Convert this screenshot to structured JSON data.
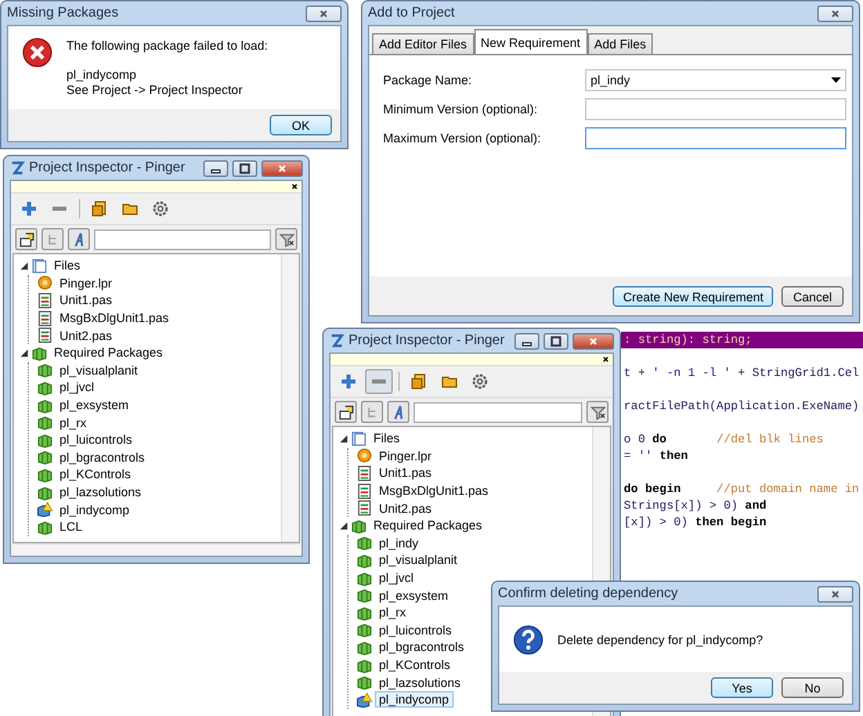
{
  "missing_packages_dialog": {
    "title": "Missing Packages",
    "message_lines": [
      "The following package failed to load:",
      "pl_indycomp",
      "See Project -> Project Inspector"
    ],
    "buttons": [
      {
        "label": "OK",
        "default": true
      }
    ]
  },
  "inspector_windows": [
    {
      "title": "Project Inspector - Pinger",
      "toolbar": [
        {
          "kind": "add",
          "pressed": false
        },
        {
          "kind": "remove",
          "pressed": false
        },
        {
          "kind": "open",
          "pressed": false
        },
        {
          "kind": "folder",
          "pressed": false
        },
        {
          "kind": "options",
          "pressed": false
        }
      ],
      "tree": [
        {
          "label": "Files",
          "kind": "files",
          "expanded": true,
          "selected": false,
          "children": [
            {
              "label": "Pinger.lpr",
              "kind": "project",
              "selected": false
            },
            {
              "label": "Unit1.pas",
              "kind": "unit",
              "selected": false
            },
            {
              "label": "MsgBxDlgUnit1.pas",
              "kind": "unit",
              "selected": false
            },
            {
              "label": "Unit2.pas",
              "kind": "unit",
              "selected": false
            }
          ]
        },
        {
          "label": "Required Packages",
          "kind": "packages",
          "expanded": true,
          "selected": false,
          "children": [
            {
              "label": "pl_visualplanit",
              "kind": "package",
              "selected": false
            },
            {
              "label": "pl_jvcl",
              "kind": "package",
              "selected": false
            },
            {
              "label": "pl_exsystem",
              "kind": "package",
              "selected": false
            },
            {
              "label": "pl_rx",
              "kind": "package",
              "selected": false
            },
            {
              "label": "pl_luicontrols",
              "kind": "package",
              "selected": false
            },
            {
              "label": "pl_bgracontrols",
              "kind": "package",
              "selected": false
            },
            {
              "label": "pl_KControls",
              "kind": "package",
              "selected": false
            },
            {
              "label": "pl_lazsolutions",
              "kind": "package",
              "selected": false
            },
            {
              "label": "pl_indycomp",
              "kind": "missing-package",
              "selected": false
            },
            {
              "label": "LCL",
              "kind": "package",
              "selected": false
            }
          ]
        }
      ]
    },
    {
      "title": "Project Inspector - Pinger",
      "toolbar": [
        {
          "kind": "add",
          "pressed": false
        },
        {
          "kind": "remove",
          "pressed": true
        },
        {
          "kind": "open",
          "pressed": false
        },
        {
          "kind": "folder",
          "pressed": false
        },
        {
          "kind": "options",
          "pressed": false
        }
      ],
      "tree": [
        {
          "label": "Files",
          "kind": "files",
          "expanded": true,
          "selected": false,
          "children": [
            {
              "label": "Pinger.lpr",
              "kind": "project",
              "selected": false
            },
            {
              "label": "Unit1.pas",
              "kind": "unit",
              "selected": false
            },
            {
              "label": "MsgBxDlgUnit1.pas",
              "kind": "unit",
              "selected": false
            },
            {
              "label": "Unit2.pas",
              "kind": "unit",
              "selected": false
            }
          ]
        },
        {
          "label": "Required Packages",
          "kind": "packages",
          "expanded": true,
          "selected": false,
          "children": [
            {
              "label": "pl_indy",
              "kind": "package",
              "selected": false
            },
            {
              "label": "pl_visualplanit",
              "kind": "package",
              "selected": false
            },
            {
              "label": "pl_jvcl",
              "kind": "package",
              "selected": false
            },
            {
              "label": "pl_exsystem",
              "kind": "package",
              "selected": false
            },
            {
              "label": "pl_rx",
              "kind": "package",
              "selected": false
            },
            {
              "label": "pl_luicontrols",
              "kind": "package",
              "selected": false
            },
            {
              "label": "pl_bgracontrols",
              "kind": "package",
              "selected": false
            },
            {
              "label": "pl_KControls",
              "kind": "package",
              "selected": false
            },
            {
              "label": "pl_lazsolutions",
              "kind": "package",
              "selected": false
            },
            {
              "label": "pl_indycomp",
              "kind": "missing-package",
              "selected": true
            }
          ]
        }
      ]
    }
  ],
  "add_to_project_dialog": {
    "title": "Add to Project",
    "tabs": [
      {
        "label": "Add Editor Files",
        "selected": false
      },
      {
        "label": "New Requirement",
        "selected": true
      },
      {
        "label": "Add Files",
        "selected": false
      }
    ],
    "fields": [
      {
        "label": "Package Name:",
        "kind": "combo",
        "value": "pl_indy",
        "focused": false
      },
      {
        "label": "Minimum Version (optional):",
        "kind": "text",
        "focused": false
      },
      {
        "label": "Maximum Version (optional):",
        "kind": "text",
        "focused": true
      }
    ],
    "buttons": [
      {
        "label": "Create New Requirement",
        "default": true
      },
      {
        "label": "Cancel",
        "default": false
      }
    ]
  },
  "source_editor": {
    "blocks": [
      [
        {
          "highlighted": true,
          "segments": [
            {
              "kind": "plain",
              "text": ": string): string;"
            }
          ]
        }
      ],
      [
        {
          "highlighted": false,
          "segments": [
            {
              "kind": "plain",
              "text": "t + "
            },
            {
              "kind": "string",
              "text": "' -n 1 -l '"
            },
            {
              "kind": "plain",
              "text": " + StringGrid1.Cel"
            }
          ]
        }
      ],
      [
        {
          "highlighted": false,
          "segments": [
            {
              "kind": "plain",
              "text": "ractFilePath(Application.ExeName)"
            }
          ]
        }
      ],
      [
        {
          "highlighted": false,
          "segments": [
            {
              "kind": "plain",
              "text": "o 0 "
            },
            {
              "kind": "keyword",
              "text": "do"
            },
            {
              "kind": "comment",
              "text": "       //del blk lines"
            }
          ]
        },
        {
          "highlighted": false,
          "segments": [
            {
              "kind": "plain",
              "text": "= "
            },
            {
              "kind": "string",
              "text": "''"
            },
            {
              "kind": "keyword",
              "text": " then"
            }
          ]
        }
      ],
      [
        {
          "highlighted": false,
          "segments": [
            {
              "kind": "keyword",
              "text": "do begin"
            },
            {
              "kind": "comment",
              "text": "     //put domain name in"
            }
          ]
        },
        {
          "highlighted": false,
          "segments": [
            {
              "kind": "plain",
              "text": "Strings[x]) > 0) "
            },
            {
              "kind": "keyword",
              "text": "and"
            }
          ]
        },
        {
          "highlighted": false,
          "segments": [
            {
              "kind": "plain",
              "text": "[x]) > 0) "
            },
            {
              "kind": "keyword",
              "text": "then begin"
            }
          ]
        }
      ]
    ]
  },
  "confirm_dialog": {
    "title": "Confirm deleting dependency",
    "message": "Delete dependency for pl_indycomp?",
    "buttons": [
      {
        "label": "Yes",
        "default": true
      },
      {
        "label": "No",
        "default": false
      }
    ]
  }
}
